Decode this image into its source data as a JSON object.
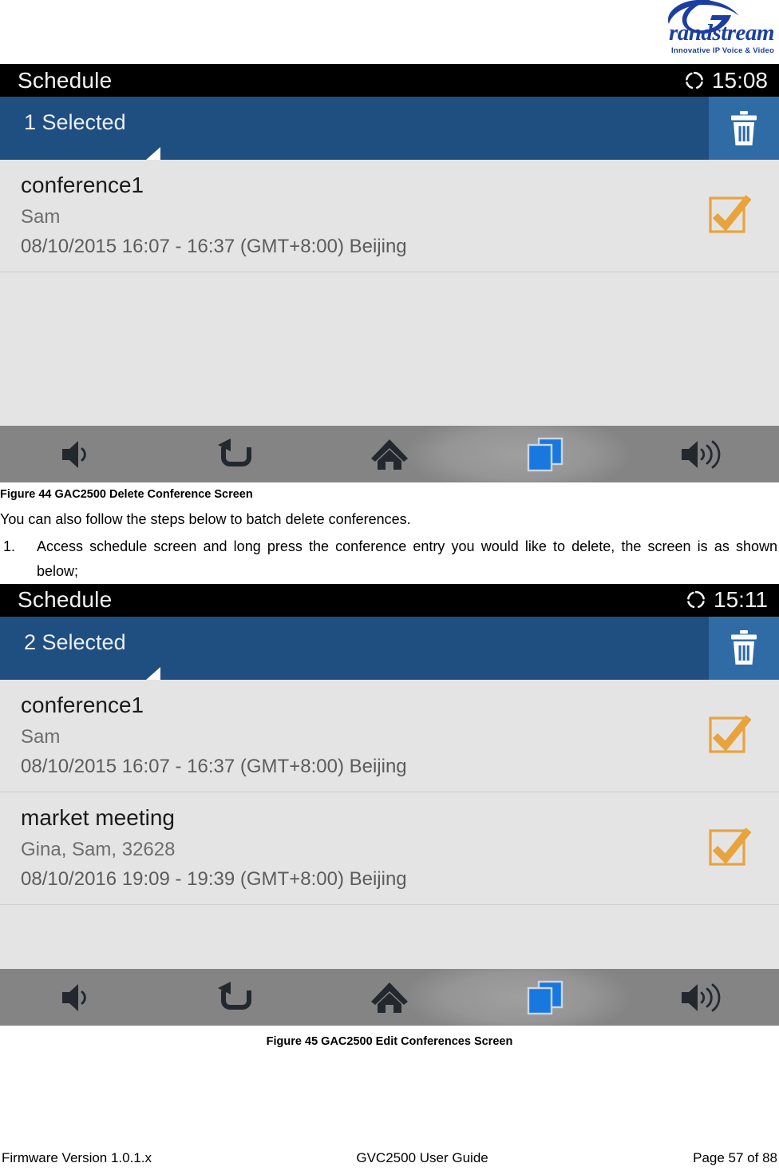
{
  "logo": {
    "wordmark": "randstream",
    "tagline": "Innovative IP Voice & Video"
  },
  "screens": [
    {
      "statusbar": {
        "title": "Schedule",
        "clock": "15:08",
        "icon": "sync-icon"
      },
      "actionbar": {
        "title": "1 Selected",
        "delete_icon": "trash-icon"
      },
      "rows": [
        {
          "title": "conference1",
          "subtitle": "Sam",
          "time": "08/10/2015 16:07 - 16:37 (GMT+8:00) Beijing",
          "checkbox": "checked-box-icon"
        }
      ],
      "navbar": [
        {
          "name": "volume-down-icon",
          "label": "Volume Down"
        },
        {
          "name": "back-icon",
          "label": "Back"
        },
        {
          "name": "home-icon",
          "label": "Home"
        },
        {
          "name": "recent-apps-icon",
          "label": "Recent Apps"
        },
        {
          "name": "volume-up-icon",
          "label": "Volume Up"
        }
      ]
    },
    {
      "statusbar": {
        "title": "Schedule",
        "clock": "15:11",
        "icon": "sync-icon"
      },
      "actionbar": {
        "title": "2 Selected",
        "delete_icon": "trash-icon"
      },
      "rows": [
        {
          "title": "conference1",
          "subtitle": "Sam",
          "time": "08/10/2015 16:07 - 16:37 (GMT+8:00) Beijing",
          "checkbox": "checked-box-icon"
        },
        {
          "title": "market meeting",
          "subtitle": "Gina, Sam, 32628",
          "time": "08/10/2016 19:09 - 19:39 (GMT+8:00) Beijing",
          "checkbox": "checked-box-icon"
        }
      ],
      "navbar": [
        {
          "name": "volume-down-icon",
          "label": "Volume Down"
        },
        {
          "name": "back-icon",
          "label": "Back"
        },
        {
          "name": "home-icon",
          "label": "Home"
        },
        {
          "name": "recent-apps-icon",
          "label": "Recent Apps"
        },
        {
          "name": "volume-up-icon",
          "label": "Volume Up"
        }
      ]
    }
  ],
  "document": {
    "figure44_caption": "Figure 44 GAC2500 Delete Conference Screen",
    "paragraph": "You can also follow the steps below to batch delete conferences.",
    "step1_number": "1.",
    "step1_text": "Access schedule screen and long press the conference entry you would like to delete, the screen is as shown below;",
    "figure45_caption": "Figure 45 GAC2500 Edit Conferences Screen",
    "footer_left": "Firmware Version 1.0.1.x",
    "footer_center": "GVC2500 User Guide",
    "footer_right": "Page 57 of 88"
  },
  "colors": {
    "actionbar_blue": "#1f4e80",
    "delete_button_blue": "#2f6ca5",
    "checkbox_orange": "#e8a33d",
    "recent_apps_blue": "#1878e0",
    "list_background": "#e4e4e4",
    "navbar_gray": "#848484",
    "logo_blue": "#1b3fa0"
  }
}
